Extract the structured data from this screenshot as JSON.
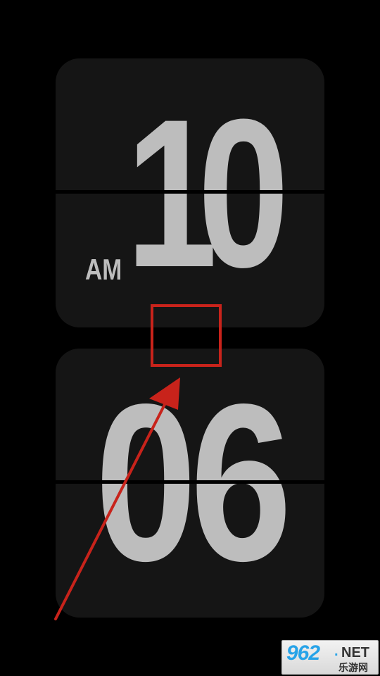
{
  "clock": {
    "hours": "10",
    "minutes": "06",
    "period": "AM"
  },
  "annotation": {
    "color": "#c8231b",
    "shapes": [
      "highlight-box",
      "pointer-arrow"
    ]
  },
  "watermark": {
    "number": "962",
    "dot": ".",
    "tld": "NET",
    "chinese": "乐游网",
    "accent": "#27a3e8"
  },
  "colors": {
    "background": "#000000",
    "card": "#151515",
    "digits": "#bdbdbd"
  }
}
